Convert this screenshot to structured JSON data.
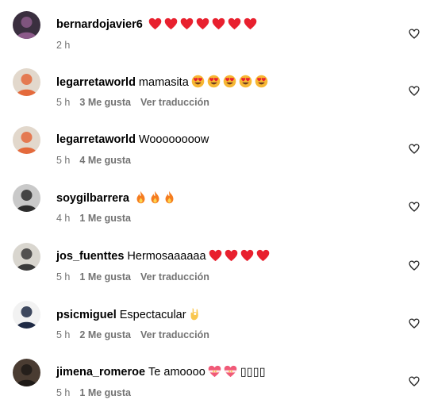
{
  "comments": [
    {
      "username": "bernardojavier6",
      "text": "",
      "emojis": [
        "red-heart",
        "red-heart",
        "red-heart",
        "red-heart",
        "red-heart",
        "red-heart",
        "red-heart"
      ],
      "time": "2 h",
      "likes": "",
      "translate": "",
      "avatar_colors": [
        "#3a2f3f",
        "#8c5a8a"
      ]
    },
    {
      "username": "legarretaworld",
      "text": "mamasita",
      "emojis": [
        "heart-eyes",
        "heart-eyes",
        "heart-eyes",
        "heart-eyes",
        "heart-eyes"
      ],
      "time": "5 h",
      "likes": "3 Me gusta",
      "translate": "Ver traducción",
      "avatar_colors": [
        "#e2d8cc",
        "#e46a3c"
      ]
    },
    {
      "username": "legarretaworld",
      "text": "Woooooooow",
      "emojis": [],
      "time": "5 h",
      "likes": "4 Me gusta",
      "translate": "",
      "avatar_colors": [
        "#e2d8cc",
        "#e46a3c"
      ]
    },
    {
      "username": "soygilbarrera",
      "text": "",
      "emojis": [
        "fire",
        "fire",
        "fire"
      ],
      "time": "4 h",
      "likes": "1 Me gusta",
      "translate": "",
      "avatar_colors": [
        "#c9c9c9",
        "#2d2d2d"
      ]
    },
    {
      "username": "jos_fuenttes",
      "text": "Hermosaaaaaa",
      "emojis": [
        "red-heart",
        "red-heart",
        "red-heart",
        "red-heart"
      ],
      "time": "5 h",
      "likes": "1 Me gusta",
      "translate": "Ver traducción",
      "avatar_colors": [
        "#d9d6cf",
        "#3a3a3a"
      ]
    },
    {
      "username": "psicmiguel",
      "text": "Espectacular",
      "emojis": [
        "ok-hand"
      ],
      "time": "5 h",
      "likes": "2 Me gusta",
      "translate": "Ver traducción",
      "avatar_colors": [
        "#f2f2f2",
        "#1f2a44"
      ]
    },
    {
      "username": "jimena_romeroe",
      "text": "Te amoooo",
      "emojis": [
        "heart-ribbon",
        "heart-ribbon"
      ],
      "trailing_text": "▯▯▯▯",
      "time": "5 h",
      "likes": "1 Me gusta",
      "translate": "",
      "avatar_colors": [
        "#4a3c32",
        "#1e1a17"
      ]
    }
  ],
  "colors": {
    "meta_text": "#737373",
    "red_heart": "#e8202e",
    "fire": "#f57c1f"
  },
  "icons": {
    "like_button": "heart-outline-icon"
  }
}
